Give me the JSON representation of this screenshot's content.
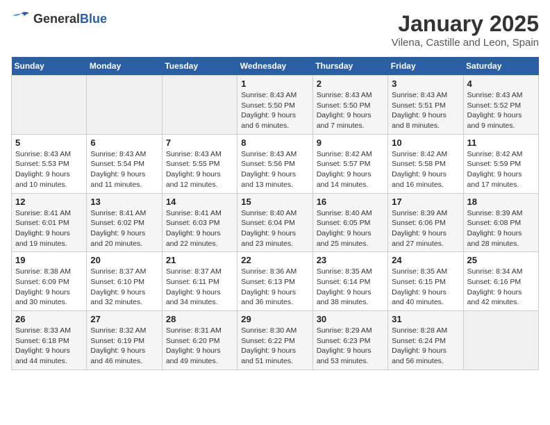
{
  "logo": {
    "general": "General",
    "blue": "Blue"
  },
  "title": "January 2025",
  "subtitle": "Vilena, Castille and Leon, Spain",
  "weekdays": [
    "Sunday",
    "Monday",
    "Tuesday",
    "Wednesday",
    "Thursday",
    "Friday",
    "Saturday"
  ],
  "weeks": [
    [
      {
        "day": "",
        "info": ""
      },
      {
        "day": "",
        "info": ""
      },
      {
        "day": "",
        "info": ""
      },
      {
        "day": "1",
        "info": "Sunrise: 8:43 AM\nSunset: 5:50 PM\nDaylight: 9 hours and 6 minutes."
      },
      {
        "day": "2",
        "info": "Sunrise: 8:43 AM\nSunset: 5:50 PM\nDaylight: 9 hours and 7 minutes."
      },
      {
        "day": "3",
        "info": "Sunrise: 8:43 AM\nSunset: 5:51 PM\nDaylight: 9 hours and 8 minutes."
      },
      {
        "day": "4",
        "info": "Sunrise: 8:43 AM\nSunset: 5:52 PM\nDaylight: 9 hours and 9 minutes."
      }
    ],
    [
      {
        "day": "5",
        "info": "Sunrise: 8:43 AM\nSunset: 5:53 PM\nDaylight: 9 hours and 10 minutes."
      },
      {
        "day": "6",
        "info": "Sunrise: 8:43 AM\nSunset: 5:54 PM\nDaylight: 9 hours and 11 minutes."
      },
      {
        "day": "7",
        "info": "Sunrise: 8:43 AM\nSunset: 5:55 PM\nDaylight: 9 hours and 12 minutes."
      },
      {
        "day": "8",
        "info": "Sunrise: 8:43 AM\nSunset: 5:56 PM\nDaylight: 9 hours and 13 minutes."
      },
      {
        "day": "9",
        "info": "Sunrise: 8:42 AM\nSunset: 5:57 PM\nDaylight: 9 hours and 14 minutes."
      },
      {
        "day": "10",
        "info": "Sunrise: 8:42 AM\nSunset: 5:58 PM\nDaylight: 9 hours and 16 minutes."
      },
      {
        "day": "11",
        "info": "Sunrise: 8:42 AM\nSunset: 5:59 PM\nDaylight: 9 hours and 17 minutes."
      }
    ],
    [
      {
        "day": "12",
        "info": "Sunrise: 8:41 AM\nSunset: 6:01 PM\nDaylight: 9 hours and 19 minutes."
      },
      {
        "day": "13",
        "info": "Sunrise: 8:41 AM\nSunset: 6:02 PM\nDaylight: 9 hours and 20 minutes."
      },
      {
        "day": "14",
        "info": "Sunrise: 8:41 AM\nSunset: 6:03 PM\nDaylight: 9 hours and 22 minutes."
      },
      {
        "day": "15",
        "info": "Sunrise: 8:40 AM\nSunset: 6:04 PM\nDaylight: 9 hours and 23 minutes."
      },
      {
        "day": "16",
        "info": "Sunrise: 8:40 AM\nSunset: 6:05 PM\nDaylight: 9 hours and 25 minutes."
      },
      {
        "day": "17",
        "info": "Sunrise: 8:39 AM\nSunset: 6:06 PM\nDaylight: 9 hours and 27 minutes."
      },
      {
        "day": "18",
        "info": "Sunrise: 8:39 AM\nSunset: 6:08 PM\nDaylight: 9 hours and 28 minutes."
      }
    ],
    [
      {
        "day": "19",
        "info": "Sunrise: 8:38 AM\nSunset: 6:09 PM\nDaylight: 9 hours and 30 minutes."
      },
      {
        "day": "20",
        "info": "Sunrise: 8:37 AM\nSunset: 6:10 PM\nDaylight: 9 hours and 32 minutes."
      },
      {
        "day": "21",
        "info": "Sunrise: 8:37 AM\nSunset: 6:11 PM\nDaylight: 9 hours and 34 minutes."
      },
      {
        "day": "22",
        "info": "Sunrise: 8:36 AM\nSunset: 6:13 PM\nDaylight: 9 hours and 36 minutes."
      },
      {
        "day": "23",
        "info": "Sunrise: 8:35 AM\nSunset: 6:14 PM\nDaylight: 9 hours and 38 minutes."
      },
      {
        "day": "24",
        "info": "Sunrise: 8:35 AM\nSunset: 6:15 PM\nDaylight: 9 hours and 40 minutes."
      },
      {
        "day": "25",
        "info": "Sunrise: 8:34 AM\nSunset: 6:16 PM\nDaylight: 9 hours and 42 minutes."
      }
    ],
    [
      {
        "day": "26",
        "info": "Sunrise: 8:33 AM\nSunset: 6:18 PM\nDaylight: 9 hours and 44 minutes."
      },
      {
        "day": "27",
        "info": "Sunrise: 8:32 AM\nSunset: 6:19 PM\nDaylight: 9 hours and 46 minutes."
      },
      {
        "day": "28",
        "info": "Sunrise: 8:31 AM\nSunset: 6:20 PM\nDaylight: 9 hours and 49 minutes."
      },
      {
        "day": "29",
        "info": "Sunrise: 8:30 AM\nSunset: 6:22 PM\nDaylight: 9 hours and 51 minutes."
      },
      {
        "day": "30",
        "info": "Sunrise: 8:29 AM\nSunset: 6:23 PM\nDaylight: 9 hours and 53 minutes."
      },
      {
        "day": "31",
        "info": "Sunrise: 8:28 AM\nSunset: 6:24 PM\nDaylight: 9 hours and 56 minutes."
      },
      {
        "day": "",
        "info": ""
      }
    ]
  ]
}
